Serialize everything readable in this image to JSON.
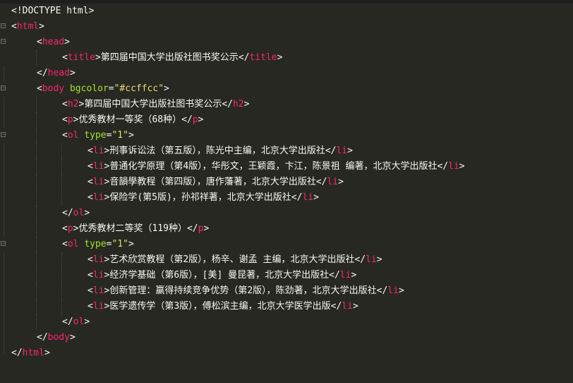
{
  "editor": {
    "theme": "monokai",
    "colors": {
      "background": "#272822",
      "tag": "#f92672",
      "attribute": "#a6e22e",
      "string": "#e6db74",
      "text": "#f8f8f2"
    }
  },
  "lines": [
    {
      "indent": 0,
      "fold": "none",
      "parts": [
        {
          "c": "p",
          "t": "<!DOCTYPE html>"
        }
      ]
    },
    {
      "indent": 0,
      "fold": "open",
      "parts": [
        {
          "c": "p",
          "t": "<"
        },
        {
          "c": "t",
          "t": "html"
        },
        {
          "c": "p",
          "t": ">"
        }
      ]
    },
    {
      "indent": 1,
      "fold": "open",
      "parts": [
        {
          "c": "p",
          "t": "<"
        },
        {
          "c": "t",
          "t": "head"
        },
        {
          "c": "p",
          "t": ">"
        }
      ]
    },
    {
      "indent": 2,
      "fold": "none",
      "parts": [
        {
          "c": "p",
          "t": "<"
        },
        {
          "c": "t",
          "t": "title"
        },
        {
          "c": "p",
          "t": ">"
        },
        {
          "c": "txt",
          "t": "第四届中国大学出版社图书奖公示"
        },
        {
          "c": "p",
          "t": "</"
        },
        {
          "c": "t",
          "t": "title"
        },
        {
          "c": "p",
          "t": ">"
        }
      ]
    },
    {
      "indent": 1,
      "fold": "line",
      "parts": [
        {
          "c": "p",
          "t": "</"
        },
        {
          "c": "t",
          "t": "head"
        },
        {
          "c": "p",
          "t": ">"
        }
      ]
    },
    {
      "indent": 1,
      "fold": "open",
      "parts": [
        {
          "c": "p",
          "t": "<"
        },
        {
          "c": "t",
          "t": "body"
        },
        {
          "c": "p",
          "t": " "
        },
        {
          "c": "a",
          "t": "bgcolor"
        },
        {
          "c": "p",
          "t": "="
        },
        {
          "c": "s",
          "t": "\"#ccffcc\""
        },
        {
          "c": "p",
          "t": ">"
        }
      ]
    },
    {
      "indent": 2,
      "fold": "line",
      "parts": [
        {
          "c": "p",
          "t": "<"
        },
        {
          "c": "t",
          "t": "h2"
        },
        {
          "c": "p",
          "t": ">"
        },
        {
          "c": "txt",
          "t": "第四届中国大学出版社图书奖公示"
        },
        {
          "c": "p",
          "t": "</"
        },
        {
          "c": "t",
          "t": "h2"
        },
        {
          "c": "p",
          "t": ">"
        }
      ]
    },
    {
      "indent": 2,
      "fold": "line",
      "parts": [
        {
          "c": "p",
          "t": "<"
        },
        {
          "c": "t",
          "t": "p"
        },
        {
          "c": "p",
          "t": ">"
        },
        {
          "c": "txt",
          "t": "优秀教材一等奖（68种）"
        },
        {
          "c": "p",
          "t": "</"
        },
        {
          "c": "t",
          "t": "p"
        },
        {
          "c": "p",
          "t": ">"
        }
      ]
    },
    {
      "indent": 2,
      "fold": "open",
      "parts": [
        {
          "c": "p",
          "t": "<"
        },
        {
          "c": "t",
          "t": "ol"
        },
        {
          "c": "p",
          "t": " "
        },
        {
          "c": "a",
          "t": "type"
        },
        {
          "c": "p",
          "t": "="
        },
        {
          "c": "s",
          "t": "\"1\""
        },
        {
          "c": "p",
          "t": ">"
        }
      ]
    },
    {
      "indent": 3,
      "fold": "line",
      "parts": [
        {
          "c": "p",
          "t": "<"
        },
        {
          "c": "t",
          "t": "li"
        },
        {
          "c": "p",
          "t": ">"
        },
        {
          "c": "txt",
          "t": "刑事诉讼法（第五版），陈光中主编，北京大学出版社"
        },
        {
          "c": "p",
          "t": "</"
        },
        {
          "c": "t",
          "t": "li"
        },
        {
          "c": "p",
          "t": ">"
        }
      ]
    },
    {
      "indent": 3,
      "fold": "line",
      "parts": [
        {
          "c": "p",
          "t": "<"
        },
        {
          "c": "t",
          "t": "li"
        },
        {
          "c": "p",
          "t": ">"
        },
        {
          "c": "txt",
          "t": "普通化学原理（第4版），华彤文，王颖霞，卞江，陈景祖 编著，北京大学出版社"
        },
        {
          "c": "p",
          "t": "</"
        },
        {
          "c": "t",
          "t": "li"
        },
        {
          "c": "p",
          "t": ">"
        }
      ]
    },
    {
      "indent": 3,
      "fold": "line",
      "parts": [
        {
          "c": "p",
          "t": "<"
        },
        {
          "c": "t",
          "t": "li"
        },
        {
          "c": "p",
          "t": ">"
        },
        {
          "c": "txt",
          "t": "音韻學教程（第四版），唐作藩著，北京大学出版社"
        },
        {
          "c": "p",
          "t": "</"
        },
        {
          "c": "t",
          "t": "li"
        },
        {
          "c": "p",
          "t": ">"
        }
      ]
    },
    {
      "indent": 3,
      "fold": "line",
      "parts": [
        {
          "c": "p",
          "t": "<"
        },
        {
          "c": "t",
          "t": "li"
        },
        {
          "c": "p",
          "t": ">"
        },
        {
          "c": "txt",
          "t": "保险学(第5版)，孙祁祥著，北京大学出版社"
        },
        {
          "c": "p",
          "t": "</"
        },
        {
          "c": "t",
          "t": "li"
        },
        {
          "c": "p",
          "t": ">"
        }
      ]
    },
    {
      "indent": 2,
      "fold": "line",
      "parts": [
        {
          "c": "p",
          "t": "</"
        },
        {
          "c": "t",
          "t": "ol"
        },
        {
          "c": "p",
          "t": ">"
        }
      ]
    },
    {
      "indent": 2,
      "fold": "line",
      "parts": [
        {
          "c": "p",
          "t": "<"
        },
        {
          "c": "t",
          "t": "p"
        },
        {
          "c": "p",
          "t": ">"
        },
        {
          "c": "txt",
          "t": "优秀教材二等奖（119种）"
        },
        {
          "c": "p",
          "t": "</"
        },
        {
          "c": "t",
          "t": "p"
        },
        {
          "c": "p",
          "t": ">"
        }
      ]
    },
    {
      "indent": 2,
      "fold": "open",
      "parts": [
        {
          "c": "p",
          "t": "<"
        },
        {
          "c": "t",
          "t": "ol"
        },
        {
          "c": "p",
          "t": " "
        },
        {
          "c": "a",
          "t": "type"
        },
        {
          "c": "p",
          "t": "="
        },
        {
          "c": "s",
          "t": "\"1\""
        },
        {
          "c": "p",
          "t": ">"
        }
      ]
    },
    {
      "indent": 3,
      "fold": "line",
      "parts": [
        {
          "c": "p",
          "t": "<"
        },
        {
          "c": "t",
          "t": "li"
        },
        {
          "c": "p",
          "t": ">"
        },
        {
          "c": "txt",
          "t": "艺术欣赏教程（第2版），杨辛、谢孟 主编，北京大学出版社"
        },
        {
          "c": "p",
          "t": "</"
        },
        {
          "c": "t",
          "t": "li"
        },
        {
          "c": "p",
          "t": ">"
        }
      ]
    },
    {
      "indent": 3,
      "fold": "line",
      "parts": [
        {
          "c": "p",
          "t": "<"
        },
        {
          "c": "t",
          "t": "li"
        },
        {
          "c": "p",
          "t": ">"
        },
        {
          "c": "txt",
          "t": "经济学基础（第6版），[美] 曼昆著，北京大学出版社"
        },
        {
          "c": "p",
          "t": "</"
        },
        {
          "c": "t",
          "t": "li"
        },
        {
          "c": "p",
          "t": ">"
        }
      ]
    },
    {
      "indent": 3,
      "fold": "line",
      "parts": [
        {
          "c": "p",
          "t": "<"
        },
        {
          "c": "t",
          "t": "li"
        },
        {
          "c": "p",
          "t": ">"
        },
        {
          "c": "txt",
          "t": "创新管理：赢得持续竞争优势（第2版），陈劲著，北京大学出版社"
        },
        {
          "c": "p",
          "t": "</"
        },
        {
          "c": "t",
          "t": "li"
        },
        {
          "c": "p",
          "t": ">"
        }
      ]
    },
    {
      "indent": 3,
      "fold": "line",
      "parts": [
        {
          "c": "p",
          "t": "<"
        },
        {
          "c": "t",
          "t": "li"
        },
        {
          "c": "p",
          "t": ">"
        },
        {
          "c": "txt",
          "t": "医学遗传学（第3版），傅松滨主编，北京大学医学出版"
        },
        {
          "c": "p",
          "t": "</"
        },
        {
          "c": "t",
          "t": "li"
        },
        {
          "c": "p",
          "t": ">"
        }
      ]
    },
    {
      "indent": 2,
      "fold": "line",
      "parts": [
        {
          "c": "p",
          "t": "</"
        },
        {
          "c": "t",
          "t": "ol"
        },
        {
          "c": "p",
          "t": ">"
        }
      ]
    },
    {
      "indent": 1,
      "fold": "line",
      "parts": [
        {
          "c": "p",
          "t": "</"
        },
        {
          "c": "t",
          "t": "body"
        },
        {
          "c": "p",
          "t": ">"
        }
      ]
    },
    {
      "indent": 0,
      "fold": "end",
      "parts": [
        {
          "c": "p",
          "t": "</"
        },
        {
          "c": "t",
          "t": "html"
        },
        {
          "c": "p",
          "t": ">"
        }
      ]
    }
  ]
}
